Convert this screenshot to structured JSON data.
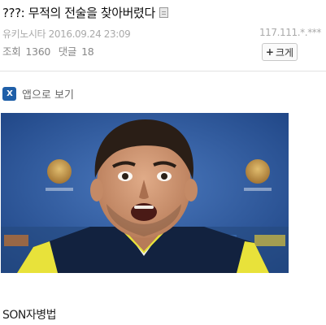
{
  "post": {
    "title": "???: 무적의 전술을 찾아버렸다",
    "author": "유키노시타",
    "datetime": "2016.09.24 23:09",
    "ip": "117.111.*.***",
    "views_label": "조회",
    "views": "1360",
    "comments_label": "댓글",
    "comments": "18",
    "add_button_label": "크게",
    "add_button_plus": "+"
  },
  "app_link": {
    "icon_text": "X",
    "label": "앱으로 보기"
  },
  "body": {
    "caption": "SON자병법"
  },
  "colors": {
    "app_icon": "#1f5fa8",
    "photo_background": "#2e5b9e",
    "jersey_navy": "#12223f",
    "jersey_yellow": "#e8e23a"
  }
}
